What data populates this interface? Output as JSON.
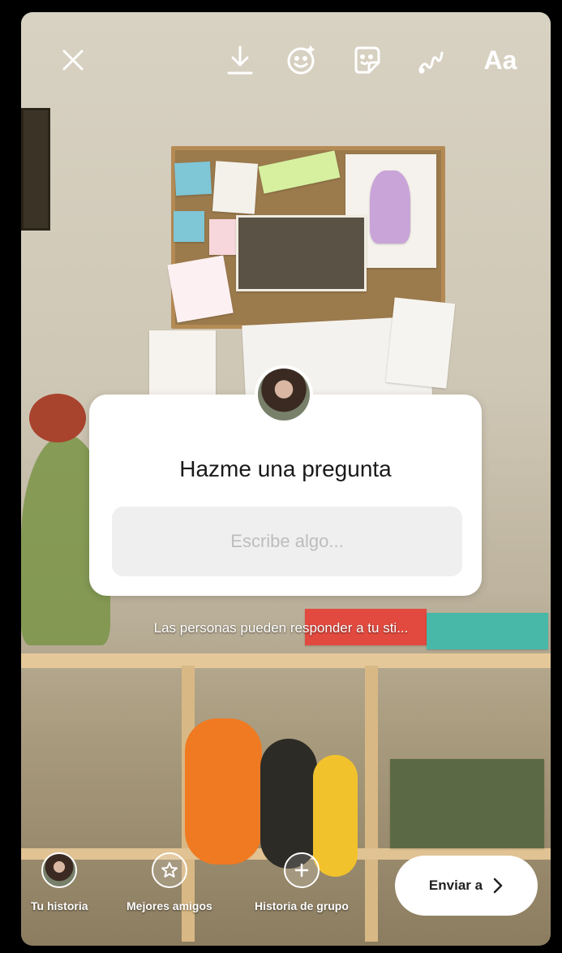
{
  "toolbar": {
    "close_icon": "close-icon",
    "download_icon": "download-icon",
    "effects_icon": "face-effects-icon",
    "sticker_icon": "sticker-icon",
    "draw_icon": "draw-icon",
    "text_label": "Aa"
  },
  "sticker": {
    "title": "Hazme una pregunta",
    "input_placeholder": "Escribe algo..."
  },
  "hint_text": "Las personas pueden responder a tu sti...",
  "bottom": {
    "your_story_label": "Tu historia",
    "close_friends_label": "Mejores amigos",
    "group_story_label": "Historia de grupo",
    "send_label": "Enviar a"
  },
  "colors": {
    "sticker_bg": "#ffffff",
    "input_bg": "#efefef"
  }
}
